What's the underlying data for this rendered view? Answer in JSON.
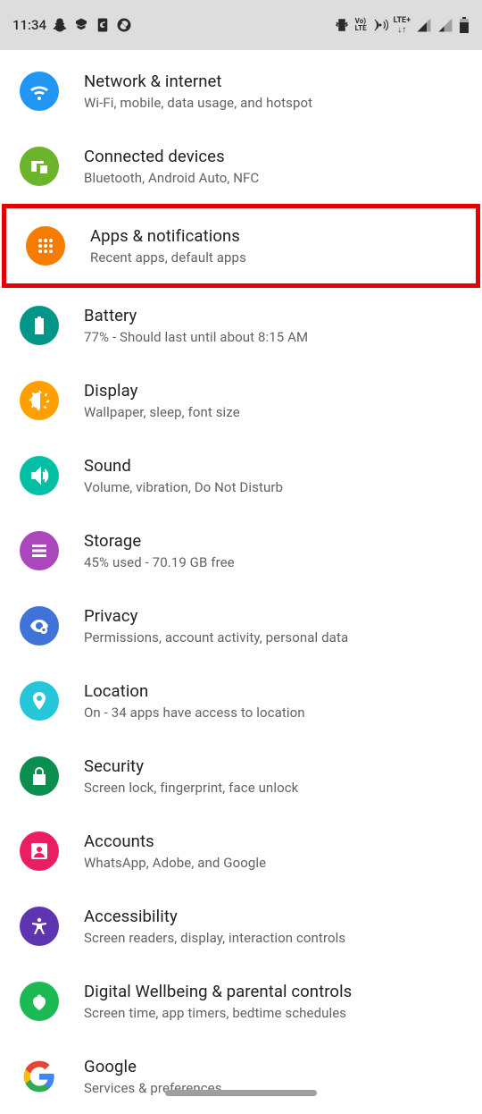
{
  "status": {
    "time": "11:34",
    "lte_label": "LTE+"
  },
  "settings": [
    {
      "id": "network",
      "title": "Network & internet",
      "sub": "Wi-Fi, mobile, data usage, and hotspot",
      "color": "#2196f3"
    },
    {
      "id": "devices",
      "title": "Connected devices",
      "sub": "Bluetooth, Android Auto, NFC",
      "color": "#6cb42c"
    },
    {
      "id": "apps",
      "title": "Apps & notifications",
      "sub": "Recent apps, default apps",
      "color": "#f57c00",
      "highlight": true
    },
    {
      "id": "battery",
      "title": "Battery",
      "sub": "77% - Should last until about 8:15 AM",
      "color": "#009688"
    },
    {
      "id": "display",
      "title": "Display",
      "sub": "Wallpaper, sleep, font size",
      "color": "#ffa000"
    },
    {
      "id": "sound",
      "title": "Sound",
      "sub": "Volume, vibration, Do Not Disturb",
      "color": "#00bfa5"
    },
    {
      "id": "storage",
      "title": "Storage",
      "sub": "45% used - 70.19 GB free",
      "color": "#ab47bc"
    },
    {
      "id": "privacy",
      "title": "Privacy",
      "sub": "Permissions, account activity, personal data",
      "color": "#3f73d8"
    },
    {
      "id": "location",
      "title": "Location",
      "sub": "On - 34 apps have access to location",
      "color": "#26c6da"
    },
    {
      "id": "security",
      "title": "Security",
      "sub": "Screen lock, fingerprint, face unlock",
      "color": "#0a8f4e"
    },
    {
      "id": "accounts",
      "title": "Accounts",
      "sub": "WhatsApp, Adobe, and Google",
      "color": "#e91e63"
    },
    {
      "id": "a11y",
      "title": "Accessibility",
      "sub": "Screen readers, display, interaction controls",
      "color": "#5e35b1"
    },
    {
      "id": "wellbeing",
      "title": "Digital Wellbeing & parental controls",
      "sub": "Screen time, app timers, bedtime schedules",
      "color": "#1db954"
    },
    {
      "id": "google",
      "title": "Google",
      "sub": "Services & preferences",
      "color": "#ffffff"
    }
  ]
}
